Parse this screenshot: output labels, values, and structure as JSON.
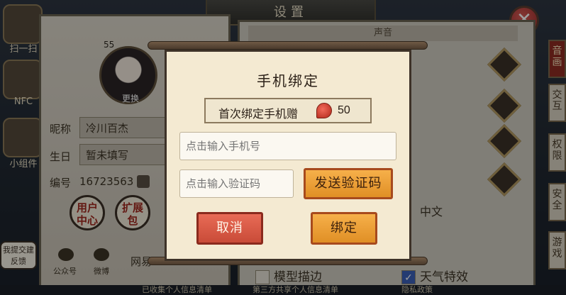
{
  "settings": {
    "title": "设置",
    "close_icon": "close-icon",
    "sound_header": "声音",
    "left_icons": [
      {
        "label": "扫一扫",
        "icon": "qr-scan-icon"
      },
      {
        "label": "NFC",
        "icon": "nfc-icon"
      },
      {
        "label": "小组件",
        "icon": "widget-icon"
      }
    ],
    "profile": {
      "level": "55",
      "change_label": "更换",
      "nickname_label": "昵称",
      "nickname_value": "冷川百杰",
      "birthday_label": "生日",
      "birthday_value": "暂未填写",
      "id_label": "编号",
      "id_value": "16723563",
      "copy_icon": "copy-icon"
    },
    "round_buttons": [
      {
        "label": "用户中心"
      },
      {
        "label": "扩展包"
      }
    ],
    "social": [
      {
        "label": "公众号",
        "icon": "wechat-icon"
      },
      {
        "label": "微博",
        "icon": "weibo-icon"
      },
      {
        "label": "网易"
      }
    ],
    "feedback_label": "我提交建反馈",
    "language_value": "中文",
    "side_tabs": [
      "音画",
      "交互",
      "权限",
      "安全",
      "游戏"
    ],
    "options": [
      {
        "label": "模型描边",
        "checked": false
      },
      {
        "label": "天气特效",
        "checked": true
      }
    ],
    "bottom_links": [
      "已收集个人信息清单",
      "第三方共享个人信息清单",
      "隐私政策"
    ]
  },
  "dialog": {
    "title": "手机绑定",
    "bonus_text": "首次绑定手机赠",
    "bonus_icon": "magatama-jade-icon",
    "bonus_amount": "50",
    "phone_placeholder": "点击输入手机号",
    "code_placeholder": "点击输入验证码",
    "send_code_label": "发送验证码",
    "cancel_label": "取消",
    "bind_label": "绑定"
  }
}
